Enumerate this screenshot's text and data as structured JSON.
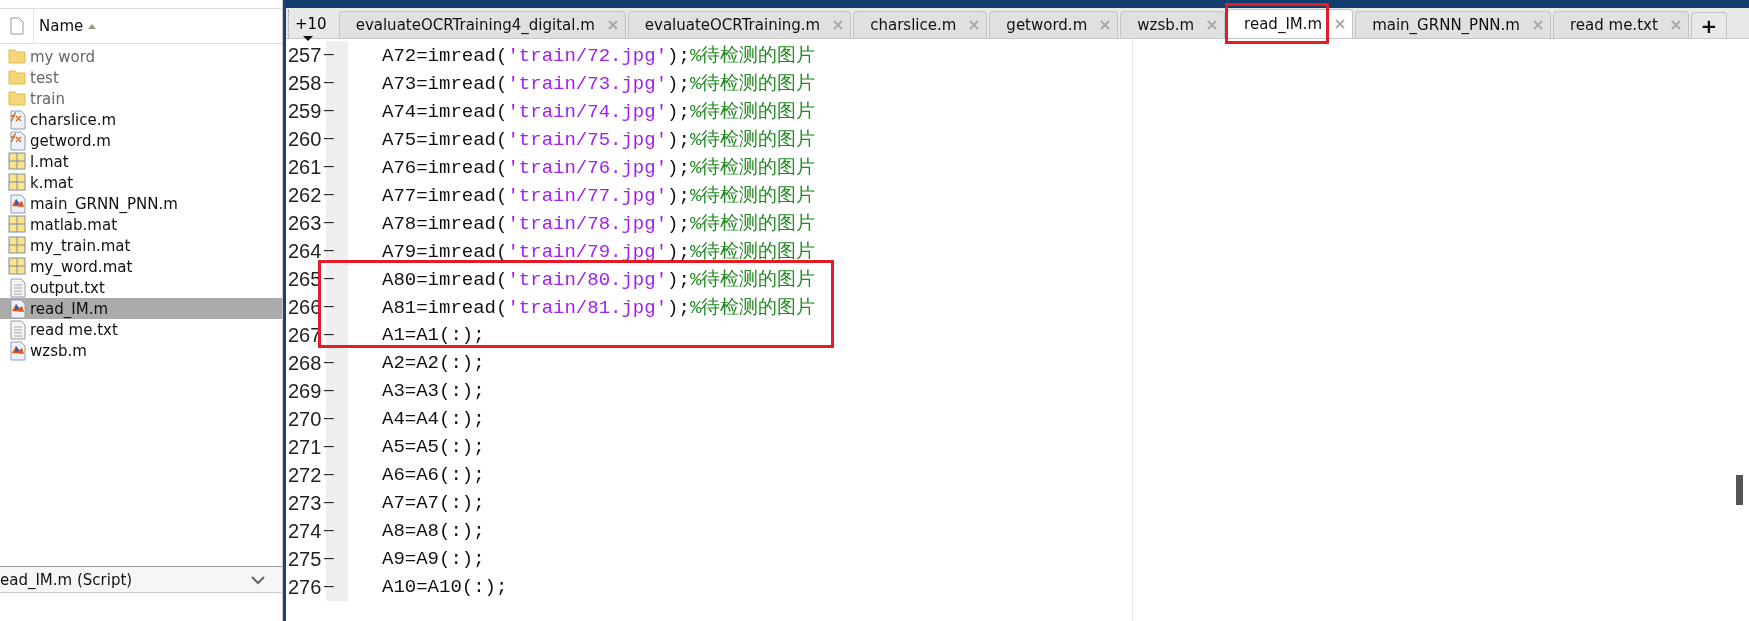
{
  "folder_panel": {
    "column_header": "Name",
    "items": [
      {
        "name": "my word",
        "kind": "folder",
        "selected": false
      },
      {
        "name": "test",
        "kind": "folder",
        "selected": false
      },
      {
        "name": "train",
        "kind": "folder",
        "selected": false
      },
      {
        "name": "charslice.m",
        "kind": "function",
        "selected": false
      },
      {
        "name": "getword.m",
        "kind": "function",
        "selected": false
      },
      {
        "name": "l.mat",
        "kind": "mat",
        "selected": false
      },
      {
        "name": "k.mat",
        "kind": "mat",
        "selected": false
      },
      {
        "name": "main_GRNN_PNN.m",
        "kind": "script",
        "selected": false
      },
      {
        "name": "matlab.mat",
        "kind": "mat",
        "selected": false
      },
      {
        "name": "my_train.mat",
        "kind": "mat",
        "selected": false
      },
      {
        "name": "my_word.mat",
        "kind": "mat",
        "selected": false
      },
      {
        "name": "output.txt",
        "kind": "text",
        "selected": false
      },
      {
        "name": "read_IM.m",
        "kind": "script",
        "selected": true
      },
      {
        "name": "read me.txt",
        "kind": "text",
        "selected": false
      },
      {
        "name": "wzsb.m",
        "kind": "script",
        "selected": false
      }
    ],
    "details": {
      "title": "ead_IM.m  (Script)",
      "expanded": false
    }
  },
  "editor": {
    "overflow_tabs": "+10",
    "tabs": [
      {
        "label": "evaluateOCRTraining4_digital.m",
        "selected": false,
        "boxed": false
      },
      {
        "label": "evaluateOCRTraining.m",
        "selected": false,
        "boxed": false
      },
      {
        "label": "charslice.m",
        "selected": false,
        "boxed": false
      },
      {
        "label": "getword.m",
        "selected": false,
        "boxed": false
      },
      {
        "label": "wzsb.m",
        "selected": false,
        "boxed": false
      },
      {
        "label": "read_IM.m",
        "selected": true,
        "boxed": true
      },
      {
        "label": "main_GRNN_PNN.m",
        "selected": false,
        "boxed": false
      },
      {
        "label": "read me.txt",
        "selected": false,
        "boxed": false
      }
    ],
    "new_tab": "+",
    "lines": [
      {
        "number": "257",
        "marker": "—",
        "boxed": false,
        "segments": [
          {
            "kind": "code",
            "text": "A72=imread("
          },
          {
            "kind": "string",
            "text": "'train/72.jpg'"
          },
          {
            "kind": "code",
            "text": ");"
          },
          {
            "kind": "comment",
            "text": "%待检测的图片"
          }
        ]
      },
      {
        "number": "258",
        "marker": "—",
        "boxed": false,
        "segments": [
          {
            "kind": "code",
            "text": "A73=imread("
          },
          {
            "kind": "string",
            "text": "'train/73.jpg'"
          },
          {
            "kind": "code",
            "text": ");"
          },
          {
            "kind": "comment",
            "text": "%待检测的图片"
          }
        ]
      },
      {
        "number": "259",
        "marker": "—",
        "boxed": false,
        "segments": [
          {
            "kind": "code",
            "text": "A74=imread("
          },
          {
            "kind": "string",
            "text": "'train/74.jpg'"
          },
          {
            "kind": "code",
            "text": ");"
          },
          {
            "kind": "comment",
            "text": "%待检测的图片"
          }
        ]
      },
      {
        "number": "260",
        "marker": "—",
        "boxed": false,
        "segments": [
          {
            "kind": "code",
            "text": "A75=imread("
          },
          {
            "kind": "string",
            "text": "'train/75.jpg'"
          },
          {
            "kind": "code",
            "text": ");"
          },
          {
            "kind": "comment",
            "text": "%待检测的图片"
          }
        ]
      },
      {
        "number": "261",
        "marker": "—",
        "boxed": false,
        "segments": [
          {
            "kind": "code",
            "text": "A76=imread("
          },
          {
            "kind": "string",
            "text": "'train/76.jpg'"
          },
          {
            "kind": "code",
            "text": ");"
          },
          {
            "kind": "comment",
            "text": "%待检测的图片"
          }
        ]
      },
      {
        "number": "262",
        "marker": "—",
        "boxed": false,
        "segments": [
          {
            "kind": "code",
            "text": "A77=imread("
          },
          {
            "kind": "string",
            "text": "'train/77.jpg'"
          },
          {
            "kind": "code",
            "text": ");"
          },
          {
            "kind": "comment",
            "text": "%待检测的图片"
          }
        ]
      },
      {
        "number": "263",
        "marker": "—",
        "boxed": false,
        "segments": [
          {
            "kind": "code",
            "text": "A78=imread("
          },
          {
            "kind": "string",
            "text": "'train/78.jpg'"
          },
          {
            "kind": "code",
            "text": ");"
          },
          {
            "kind": "comment",
            "text": "%待检测的图片"
          }
        ]
      },
      {
        "number": "264",
        "marker": "—",
        "boxed": false,
        "segments": [
          {
            "kind": "code",
            "text": "A79=imread("
          },
          {
            "kind": "string",
            "text": "'train/79.jpg'"
          },
          {
            "kind": "code",
            "text": ");"
          },
          {
            "kind": "comment",
            "text": "%待检测的图片"
          }
        ]
      },
      {
        "number": "265",
        "marker": "—",
        "boxed": true,
        "segments": [
          {
            "kind": "code",
            "text": "A80=imread("
          },
          {
            "kind": "string",
            "text": "'train/80.jpg'"
          },
          {
            "kind": "code",
            "text": ");"
          },
          {
            "kind": "comment",
            "text": "%待检测的图片"
          }
        ]
      },
      {
        "number": "266",
        "marker": "—",
        "boxed": true,
        "segments": [
          {
            "kind": "code",
            "text": "A81=imread("
          },
          {
            "kind": "string",
            "text": "'train/81.jpg'"
          },
          {
            "kind": "code",
            "text": ");"
          },
          {
            "kind": "comment",
            "text": "%待检测的图片"
          }
        ]
      },
      {
        "number": "267",
        "marker": "—",
        "boxed": true,
        "segments": [
          {
            "kind": "code",
            "text": "A1=A1(:);"
          }
        ]
      },
      {
        "number": "268",
        "marker": "—",
        "boxed": false,
        "segments": [
          {
            "kind": "code",
            "text": "A2=A2(:);"
          }
        ]
      },
      {
        "number": "269",
        "marker": "—",
        "boxed": false,
        "segments": [
          {
            "kind": "code",
            "text": "A3=A3(:);"
          }
        ]
      },
      {
        "number": "270",
        "marker": "—",
        "boxed": false,
        "segments": [
          {
            "kind": "code",
            "text": "A4=A4(:);"
          }
        ]
      },
      {
        "number": "271",
        "marker": "—",
        "boxed": false,
        "segments": [
          {
            "kind": "code",
            "text": "A5=A5(:);"
          }
        ]
      },
      {
        "number": "272",
        "marker": "—",
        "boxed": false,
        "segments": [
          {
            "kind": "code",
            "text": "A6=A6(:);"
          }
        ]
      },
      {
        "number": "273",
        "marker": "—",
        "boxed": false,
        "segments": [
          {
            "kind": "code",
            "text": "A7=A7(:);"
          }
        ]
      },
      {
        "number": "274",
        "marker": "—",
        "boxed": false,
        "segments": [
          {
            "kind": "code",
            "text": "A8=A8(:);"
          }
        ]
      },
      {
        "number": "275",
        "marker": "—",
        "boxed": false,
        "segments": [
          {
            "kind": "code",
            "text": "A9=A9(:);"
          }
        ]
      },
      {
        "number": "276",
        "marker": "—",
        "boxed": false,
        "segments": [
          {
            "kind": "code",
            "text": "A10=A10(:);"
          }
        ]
      }
    ]
  }
}
